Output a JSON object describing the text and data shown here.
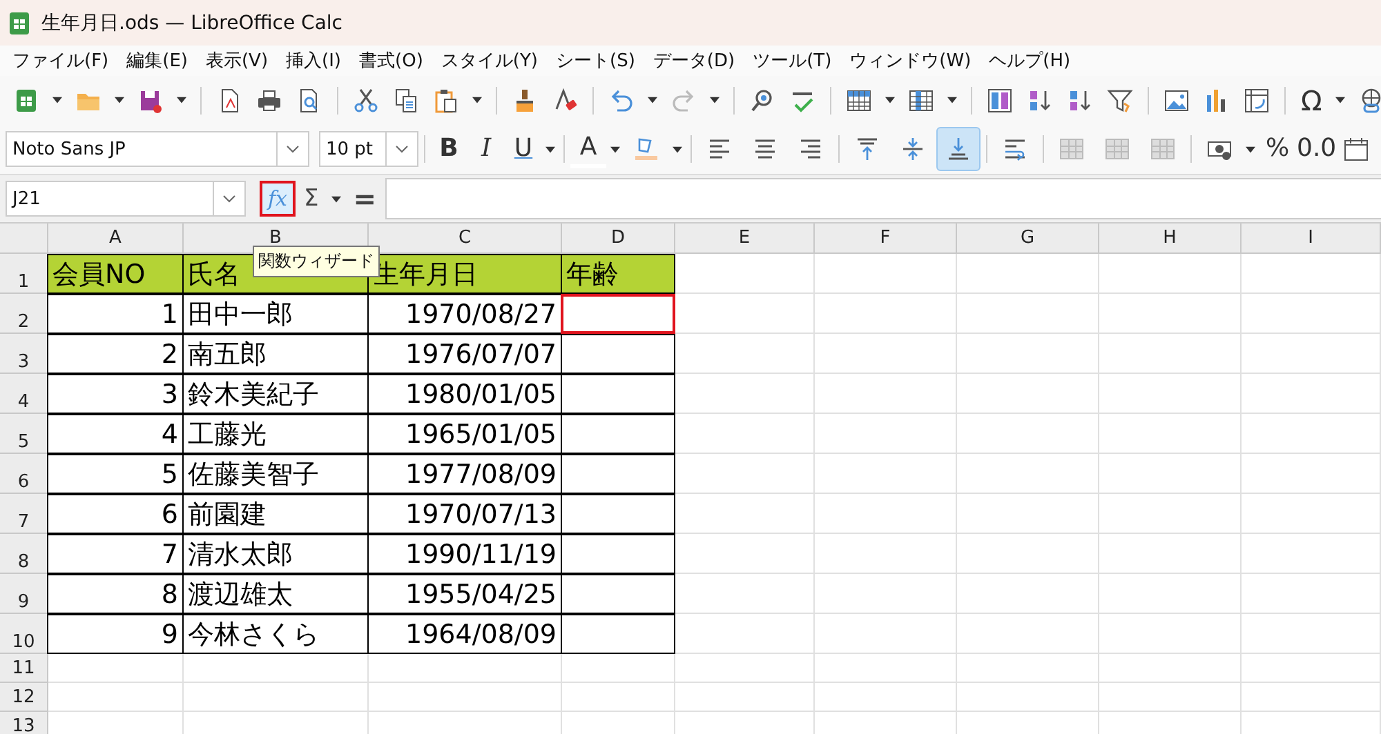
{
  "window": {
    "title": "生年月日.ods — LibreOffice Calc"
  },
  "menu": [
    "ファイル(F)",
    "編集(E)",
    "表示(V)",
    "挿入(I)",
    "書式(O)",
    "スタイル(Y)",
    "シート(S)",
    "データ(D)",
    "ツール(T)",
    "ウィンドウ(W)",
    "ヘルプ(H)"
  ],
  "toolbar": [
    {
      "kind": "sheet"
    },
    {
      "kind": "caret"
    },
    {
      "kind": "folder"
    },
    {
      "kind": "caret"
    },
    {
      "kind": "floppy"
    },
    {
      "kind": "caret"
    },
    {
      "kind": "sep"
    },
    {
      "kind": "pdf"
    },
    {
      "kind": "printer"
    },
    {
      "kind": "preview"
    },
    {
      "kind": "sep"
    },
    {
      "kind": "scissors"
    },
    {
      "kind": "copy"
    },
    {
      "kind": "paste"
    },
    {
      "kind": "caret"
    },
    {
      "kind": "sep"
    },
    {
      "kind": "brush"
    },
    {
      "kind": "eraser"
    },
    {
      "kind": "sep"
    },
    {
      "kind": "undo"
    },
    {
      "kind": "caret"
    },
    {
      "kind": "redo"
    },
    {
      "kind": "caret"
    },
    {
      "kind": "sep"
    },
    {
      "kind": "find"
    },
    {
      "kind": "spell"
    },
    {
      "kind": "sep"
    },
    {
      "kind": "rows"
    },
    {
      "kind": "caret"
    },
    {
      "kind": "cols"
    },
    {
      "kind": "caret"
    },
    {
      "kind": "sep"
    },
    {
      "kind": "sort"
    },
    {
      "kind": "sortasc"
    },
    {
      "kind": "sortdesc"
    },
    {
      "kind": "funnel"
    },
    {
      "kind": "sep"
    },
    {
      "kind": "image"
    },
    {
      "kind": "chart"
    },
    {
      "kind": "pivot"
    },
    {
      "kind": "sep"
    },
    {
      "kind": "glyph",
      "text": "Ω"
    },
    {
      "kind": "caret"
    },
    {
      "kind": "globe"
    }
  ],
  "format_bar": {
    "font": "Noto Sans JP",
    "size": "10 pt",
    "items": [
      {
        "kind": "sep"
      },
      {
        "kind": "glyph",
        "text": "B"
      },
      {
        "kind": "glyph",
        "text": "I"
      },
      {
        "kind": "glyph",
        "text": "U"
      },
      {
        "kind": "caret"
      },
      {
        "kind": "sep"
      },
      {
        "kind": "glyph",
        "text": "A"
      },
      {
        "kind": "caret"
      },
      {
        "kind": "highlight"
      },
      {
        "kind": "caret"
      },
      {
        "kind": "sep"
      },
      {
        "kind": "alignleft"
      },
      {
        "kind": "aligncenter"
      },
      {
        "kind": "alignright"
      },
      {
        "kind": "sep"
      },
      {
        "kind": "aligntop",
        "selected": false
      },
      {
        "kind": "alignmiddle",
        "selected": false
      },
      {
        "kind": "alignbottom",
        "selected": true
      },
      {
        "kind": "sep"
      },
      {
        "kind": "wrap"
      },
      {
        "kind": "sep"
      },
      {
        "kind": "merge"
      },
      {
        "kind": "merge"
      },
      {
        "kind": "merge"
      },
      {
        "kind": "sep"
      },
      {
        "kind": "currency"
      },
      {
        "kind": "caret"
      },
      {
        "kind": "glyph",
        "text": "%"
      },
      {
        "kind": "glyph",
        "text": "0.0"
      },
      {
        "kind": "calendar"
      }
    ]
  },
  "formula_bar": {
    "name_box": "J21",
    "function_wizard": {
      "text": "fx",
      "annotated": true
    },
    "sum": "Σ",
    "equals": "=",
    "tooltip": "関数ウィザード"
  },
  "sheet": {
    "columns": [
      "A",
      "B",
      "C",
      "D",
      "E",
      "F",
      "G",
      "H",
      "I"
    ],
    "rows": [
      {
        "number": "1",
        "kind": "header",
        "cells": [
          {
            "text": "会員NO"
          },
          {
            "text": "氏名"
          },
          {
            "text": "生年月日"
          },
          {
            "text": "年齢"
          }
        ]
      },
      {
        "number": "2",
        "kind": "data",
        "cells": [
          {
            "text": "1"
          },
          {
            "text": "田中一郎"
          },
          {
            "text": "1970/08/27"
          },
          {
            "annotated": true
          }
        ]
      },
      {
        "number": "3",
        "kind": "data",
        "cells": [
          {
            "text": "2"
          },
          {
            "text": "南五郎"
          },
          {
            "text": "1976/07/07"
          },
          {
            "annotated": false
          }
        ]
      },
      {
        "number": "4",
        "kind": "data",
        "cells": [
          {
            "text": "3"
          },
          {
            "text": "鈴木美紀子"
          },
          {
            "text": "1980/01/05"
          },
          {
            "annotated": false
          }
        ]
      },
      {
        "number": "5",
        "kind": "data",
        "cells": [
          {
            "text": "4"
          },
          {
            "text": "工藤光"
          },
          {
            "text": "1965/01/05"
          },
          {
            "annotated": false
          }
        ]
      },
      {
        "number": "6",
        "kind": "data",
        "cells": [
          {
            "text": "5"
          },
          {
            "text": "佐藤美智子"
          },
          {
            "text": "1977/08/09"
          },
          {
            "annotated": false
          }
        ]
      },
      {
        "number": "7",
        "kind": "data",
        "cells": [
          {
            "text": "6"
          },
          {
            "text": "前園建"
          },
          {
            "text": "1970/07/13"
          },
          {
            "annotated": false
          }
        ]
      },
      {
        "number": "8",
        "kind": "data",
        "cells": [
          {
            "text": "7"
          },
          {
            "text": "清水太郎"
          },
          {
            "text": "1990/11/19"
          },
          {
            "annotated": false
          }
        ]
      },
      {
        "number": "9",
        "kind": "data",
        "cells": [
          {
            "text": "8"
          },
          {
            "text": "渡辺雄太"
          },
          {
            "text": "1955/04/25"
          },
          {
            "annotated": false
          }
        ]
      },
      {
        "number": "10",
        "kind": "data",
        "cells": [
          {
            "text": "9"
          },
          {
            "text": "今林さくら"
          },
          {
            "text": "1964/08/09"
          },
          {
            "annotated": false
          }
        ]
      },
      {
        "number": "11",
        "kind": "empty"
      },
      {
        "number": "12",
        "kind": "empty"
      },
      {
        "number": "13",
        "kind": "empty"
      }
    ]
  }
}
